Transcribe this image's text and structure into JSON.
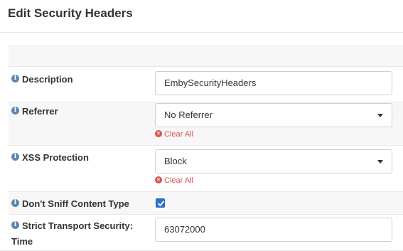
{
  "page": {
    "title": "Edit Security Headers"
  },
  "form": {
    "description": {
      "label": "Description",
      "value": "EmbySecurityHeaders"
    },
    "referrer": {
      "label": "Referrer",
      "selected": "No Referrer",
      "clear_label": "Clear All"
    },
    "xss_protection": {
      "label": "XSS Protection",
      "selected": "Block",
      "clear_label": "Clear All"
    },
    "dont_sniff": {
      "label": "Don't Sniff Content Type",
      "checked": true
    },
    "hsts_time": {
      "label_line1": "Strict Transport Security:",
      "label_line2": "Time",
      "value": "63072000"
    }
  },
  "colors": {
    "accent": "#2f6fd0",
    "danger": "#d9534f",
    "info": "#5b86b3"
  },
  "icons": {
    "info": "info-circle-icon",
    "clear": "times-circle-icon",
    "caret": "caret-down-icon",
    "check": "check-icon"
  }
}
